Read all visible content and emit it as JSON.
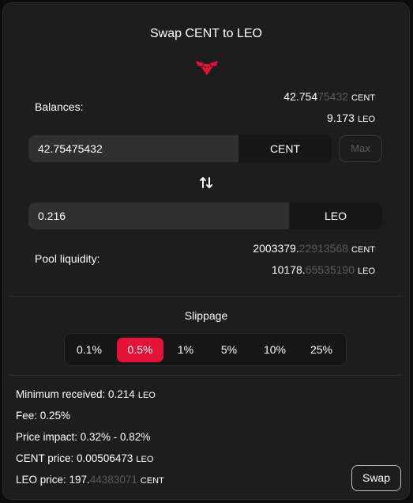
{
  "header": {
    "title": "Swap CENT to LEO",
    "logo_icon": "leo-lion-logo"
  },
  "balances": {
    "label": "Balances:",
    "cent_main": "42.754",
    "cent_dim": "75432",
    "cent_unit": "CENT",
    "leo_main": "9.173",
    "leo_unit": "LEO"
  },
  "from_field": {
    "value": "42.75475432",
    "currency": "CENT",
    "max_label": "Max"
  },
  "swap_direction_icon": "swap-arrows-icon",
  "to_field": {
    "value": "0.216",
    "currency": "LEO"
  },
  "pool": {
    "label": "Pool liquidity:",
    "cent_main": "2003379.",
    "cent_dim": "22913568",
    "cent_unit": "CENT",
    "leo_main": "10178.",
    "leo_dim": "65535190",
    "leo_unit": "LEO"
  },
  "slippage": {
    "title": "Slippage",
    "options": [
      "0.1%",
      "0.5%",
      "1%",
      "5%",
      "10%",
      "25%"
    ],
    "selected": "0.5%"
  },
  "info": {
    "min_received_label": "Minimum received: ",
    "min_received_value": "0.214",
    "min_received_unit": "LEO",
    "fee": "Fee: 0.25%",
    "price_impact": "Price impact: 0.32% - 0.82%",
    "cent_price_label": "CENT price: ",
    "cent_price_value": "0.00506473",
    "cent_price_unit": "LEO",
    "leo_price_label": "LEO price: ",
    "leo_price_main": "197.",
    "leo_price_dim": "44383071",
    "leo_price_unit": "CENT"
  },
  "actions": {
    "swap_label": "Swap"
  },
  "colors": {
    "accent": "#e31337",
    "card": "#1d1d1d",
    "field": "#303030",
    "dim_text": "#5a5a5a"
  }
}
